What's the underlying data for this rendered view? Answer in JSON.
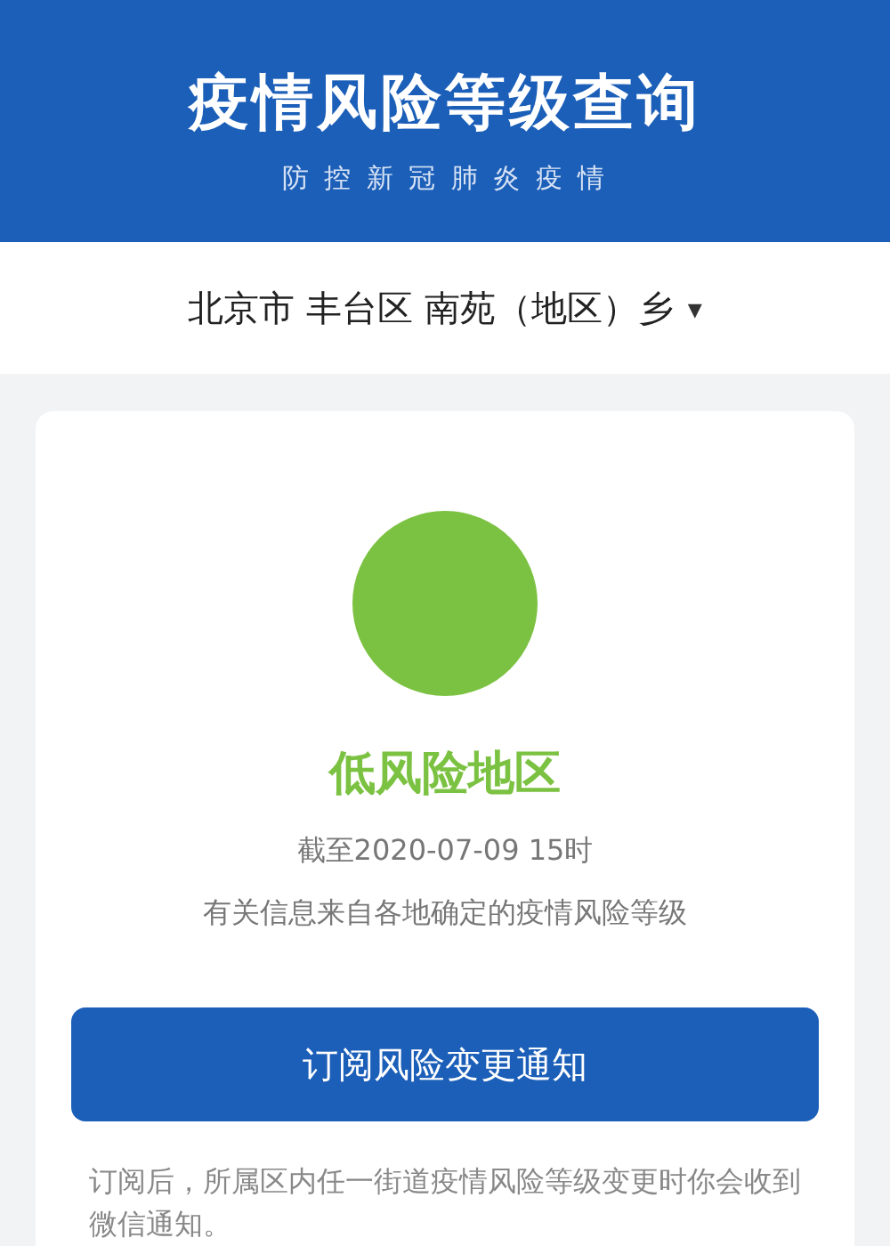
{
  "header": {
    "title": "疫情风险等级查询",
    "subtitle": "防 控 新 冠 肺 炎 疫 情"
  },
  "location": {
    "text": "北京市 丰台区 南苑（地区）乡",
    "caret": "▾"
  },
  "result": {
    "kind": "low",
    "label": "低风险地区",
    "as_of": "截至2020-07-09 15时",
    "source": "有关信息来自各地确定的疫情风险等级"
  },
  "subscribe": {
    "button": "订阅风险变更通知",
    "note": "订阅后，所属区内任一街道疫情风险等级变更时你会收到微信通知。"
  }
}
